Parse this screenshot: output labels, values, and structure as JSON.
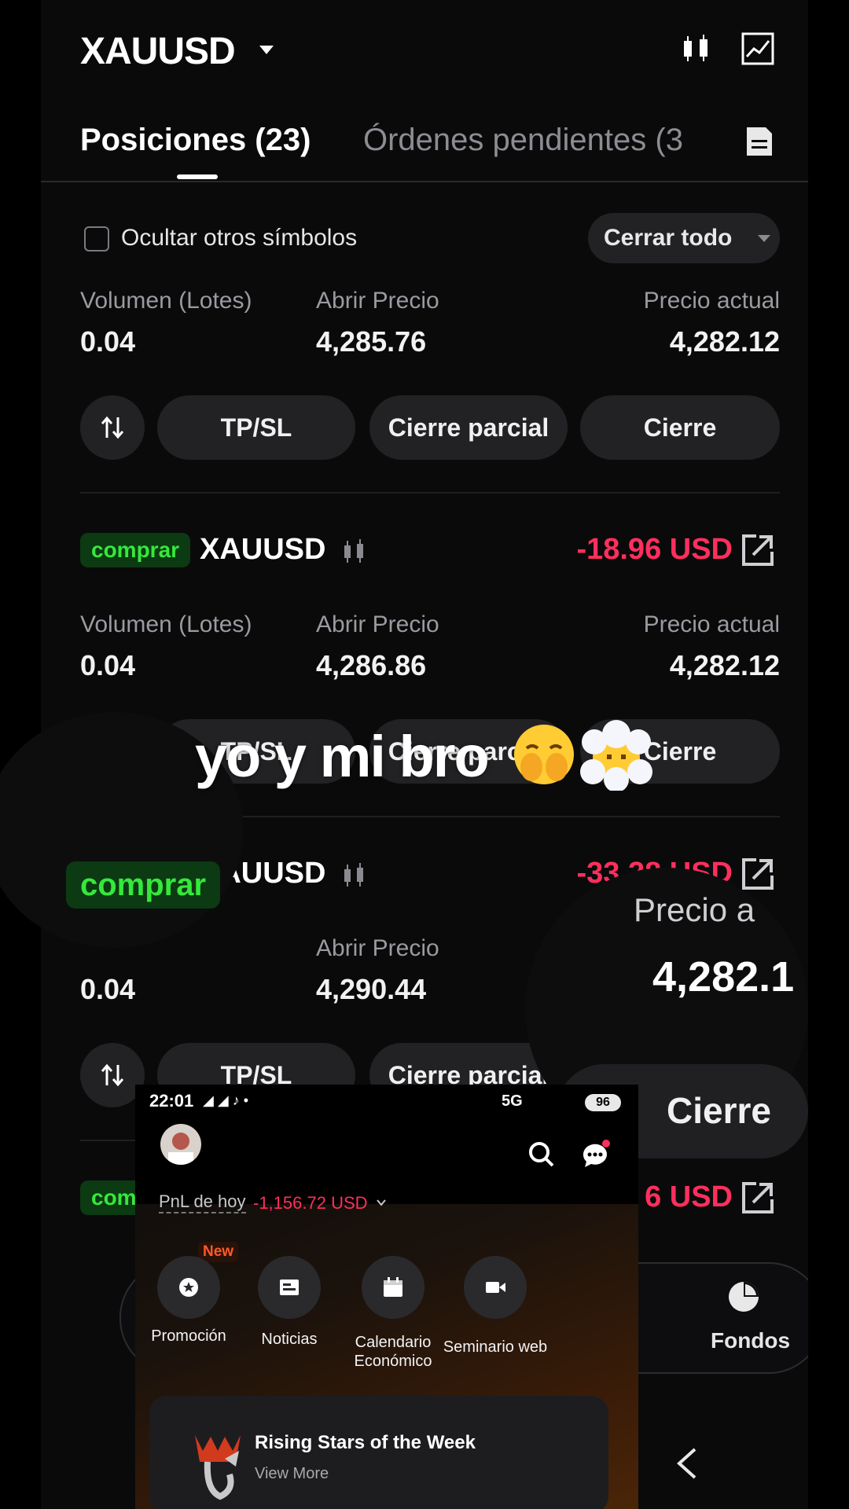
{
  "header": {
    "symbol": "XAUUSD",
    "tabs": [
      {
        "label": "Posiciones (23)",
        "active": true
      },
      {
        "label": "Órdenes pendientes (3",
        "active": false
      }
    ]
  },
  "filter": {
    "hide_others_label": "Ocultar otros símbolos",
    "hide_others_checked": false,
    "close_all_label": "Cerrar todo"
  },
  "columns": {
    "volume": "Volumen (Lotes)",
    "open_price": "Abrir Precio",
    "current_price": "Precio actual"
  },
  "actions": {
    "tpsl": "TP/SL",
    "partial_close": "Cierre parcial",
    "close": "Cierre"
  },
  "positions": [
    {
      "volume": "0.04",
      "open_price": "4,285.76",
      "current_price": "4,282.12"
    },
    {
      "side": "comprar",
      "symbol": "XAUUSD",
      "pnl": "-18.96 USD",
      "volume": "0.04",
      "open_price": "4,286.86",
      "current_price": "4,282.12"
    },
    {
      "side": "comprar",
      "symbol": "XAUUSD",
      "pnl": "-33.28 USD",
      "volume": "0.04",
      "open_price": "4,290.44",
      "current_price": "4,282.12"
    },
    {
      "side": "comprar",
      "pnl": "6 USD"
    }
  ],
  "caption": {
    "text": "yo y mi bro",
    "emojis": [
      "face-with-hand-over-mouth",
      "face-in-clouds"
    ]
  },
  "magnified": {
    "badge": "comprar",
    "price_label": "Precio a",
    "price_value": "4,282.1",
    "close_label": "Cierre"
  },
  "bottom_nav": {
    "funds_label": "Fondos"
  },
  "phone": {
    "time": "22:01",
    "network": "5G",
    "battery": "96",
    "pnl_label": "PnL de hoy",
    "pnl_value": "-1,156.72 USD",
    "new_badge": "New",
    "shortcuts": [
      "Promoción",
      "Noticias",
      "Calendario Económico",
      "Seminario web"
    ],
    "card_title": "Rising Stars of the Week",
    "card_sub": "View More"
  },
  "colors": {
    "loss": "#ff2f5d",
    "buy": "#35e83c",
    "background": "#0a0a0b"
  }
}
